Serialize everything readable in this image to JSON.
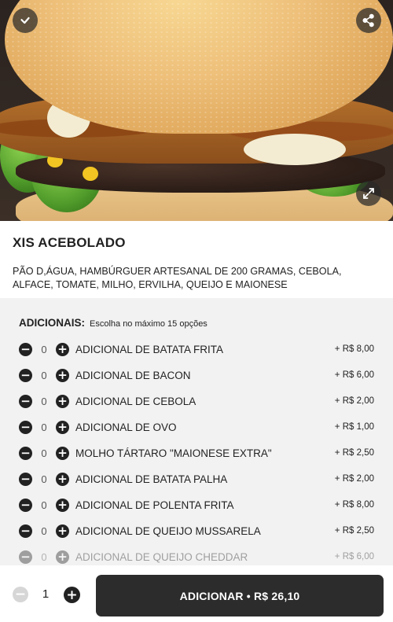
{
  "product": {
    "title": "XIS ACEBOLADO",
    "description": "PÃO D,ÁGUA, HAMBÚRGUER ARTESANAL DE 200 GRAMAS, CEBOLA, ALFACE, TOMATE, MILHO, ERVILHA, QUEIJO E MAIONESE"
  },
  "hero": {
    "left_icon": "chevron-down-icon",
    "share_icon": "share-icon",
    "expand_icon": "expand-icon"
  },
  "extras": {
    "label": "ADICIONAIS:",
    "hint": "Escolha no máximo 15 opções",
    "items": [
      {
        "name": "ADICIONAL DE BATATA FRITA",
        "qty": "0",
        "price": "+ R$ 8,00"
      },
      {
        "name": "ADICIONAL DE BACON",
        "qty": "0",
        "price": "+ R$ 6,00"
      },
      {
        "name": "ADICIONAL DE CEBOLA",
        "qty": "0",
        "price": "+ R$ 2,00"
      },
      {
        "name": "ADICIONAL DE OVO",
        "qty": "0",
        "price": "+ R$ 1,00"
      },
      {
        "name": "MOLHO TÁRTARO \"MAIONESE EXTRA\"",
        "qty": "0",
        "price": "+ R$ 2,50"
      },
      {
        "name": "ADICIONAL DE BATATA PALHA",
        "qty": "0",
        "price": "+ R$ 2,00"
      },
      {
        "name": "ADICIONAL DE POLENTA FRITA",
        "qty": "0",
        "price": "+ R$ 8,00"
      },
      {
        "name": "ADICIONAL DE QUEIJO MUSSARELA",
        "qty": "0",
        "price": "+ R$ 2,50"
      },
      {
        "name": "ADICIONAL DE QUEIJO CHEDDAR",
        "qty": "0",
        "price": "+ R$ 6,00"
      }
    ]
  },
  "footer": {
    "quantity": "1",
    "add_button": "ADICIONAR • R$ 26,10"
  },
  "colors": {
    "dark": "#2c2c2c",
    "panel": "#f2f2f2",
    "disabled": "#d6d6d6"
  }
}
